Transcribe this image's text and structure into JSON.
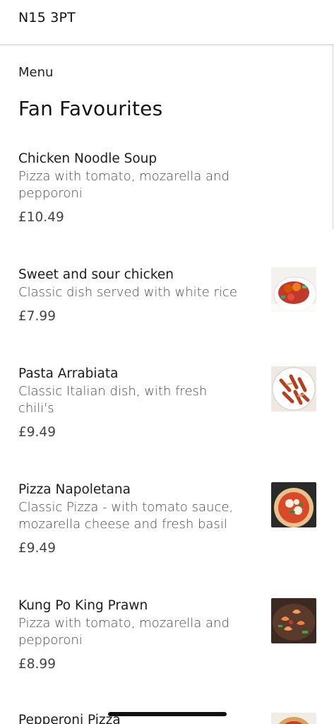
{
  "header": {
    "postcode": "N15 3PT"
  },
  "breadcrumb": "Menu",
  "section": {
    "title": "Fan Favourites"
  },
  "items": [
    {
      "name": "Chicken Noodle Soup",
      "description": "Pizza with tomato, mozarella and pepporoni",
      "price": "£10.49",
      "image": "none"
    },
    {
      "name": "Sweet and sour chicken",
      "description": "Classic dish served with white rice",
      "price": "£7.99",
      "image": "sweet-and-sour-chicken-photo"
    },
    {
      "name": "Pasta Arrabiata",
      "description": "Classic Italian dish, with fresh chili's",
      "price": "£9.49",
      "image": "pasta-arrabiata-photo"
    },
    {
      "name": "Pizza Napoletana",
      "description": "Classic Pizza - with tomato sauce, mozarella cheese and fresh basil",
      "price": "£9.49",
      "image": "pizza-napoletana-photo"
    },
    {
      "name": "Kung Po King Prawn",
      "description": "Pizza with tomato, mozarella and pepporoni",
      "price": "£8.99",
      "image": "kung-po-king-prawn-photo"
    },
    {
      "name": "Pepperoni Pizza",
      "image": "pepperoni-pizza-photo"
    }
  ]
}
